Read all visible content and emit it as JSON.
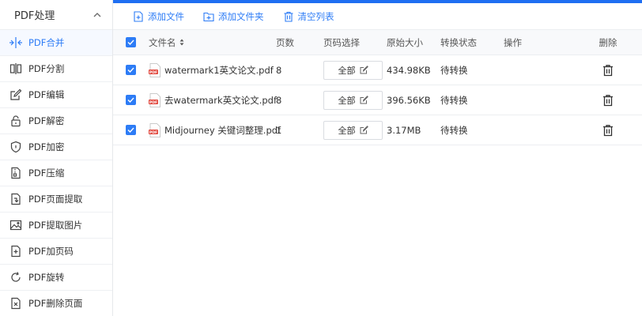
{
  "sidebar": {
    "title": "PDF处理",
    "items": [
      {
        "label": "PDF合并",
        "icon": "merge-icon",
        "active": true
      },
      {
        "label": "PDF分割",
        "icon": "split-icon"
      },
      {
        "label": "PDF编辑",
        "icon": "edit-icon"
      },
      {
        "label": "PDF解密",
        "icon": "unlock-icon"
      },
      {
        "label": "PDF加密",
        "icon": "shield-icon"
      },
      {
        "label": "PDF压缩",
        "icon": "compress-icon"
      },
      {
        "label": "PDF页面提取",
        "icon": "page-extract-icon"
      },
      {
        "label": "PDF提取图片",
        "icon": "image-icon"
      },
      {
        "label": "PDF加页码",
        "icon": "page-number-icon"
      },
      {
        "label": "PDF旋转",
        "icon": "rotate-icon"
      },
      {
        "label": "PDF删除页面",
        "icon": "delete-page-icon"
      }
    ]
  },
  "toolbar": {
    "add_file": "添加文件",
    "add_folder": "添加文件夹",
    "clear_list": "清空列表"
  },
  "table": {
    "headers": {
      "name": "文件名",
      "pages": "页数",
      "range": "页码选择",
      "size": "原始大小",
      "status": "转换状态",
      "op": "操作",
      "delete": "删除"
    },
    "rows": [
      {
        "name": "watermark1英文论文.pdf",
        "pages": "8",
        "range": "全部",
        "size": "434.98KB",
        "status": "待转换"
      },
      {
        "name": "去watermark英文论文.pdf",
        "pages": "8",
        "range": "全部",
        "size": "396.56KB",
        "status": "待转换"
      },
      {
        "name": "Midjourney 关键词整理.pdf",
        "pages": "1",
        "range": "全部",
        "size": "3.17MB",
        "status": "待转换"
      }
    ]
  },
  "colors": {
    "accent": "#2d7cf6",
    "topbar": "#1f6ff2",
    "pdf_red": "#e1463c"
  }
}
